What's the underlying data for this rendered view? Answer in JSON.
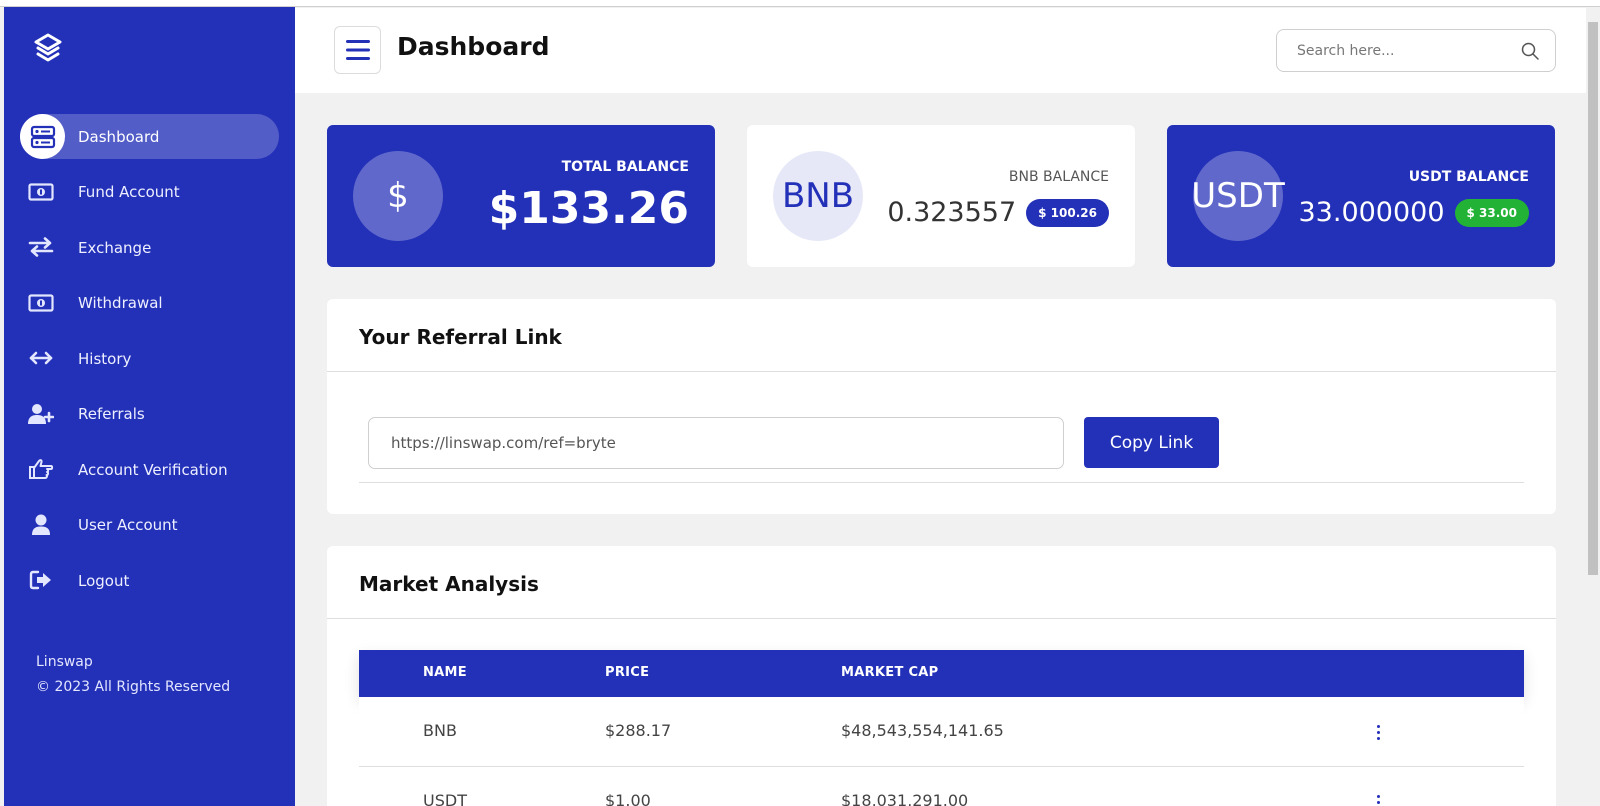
{
  "sidebar": {
    "items": [
      {
        "label": "Dashboard",
        "icon": "server-icon",
        "active": true
      },
      {
        "label": "Fund Account",
        "icon": "money-bill-icon"
      },
      {
        "label": "Exchange",
        "icon": "exchange-arrows-icon"
      },
      {
        "label": "Withdrawal",
        "icon": "money-bill-icon"
      },
      {
        "label": "History",
        "icon": "arrows-horizontal-icon"
      },
      {
        "label": "Referrals",
        "icon": "user-plus-icon"
      },
      {
        "label": "Account Verification",
        "icon": "hand-pointer-icon"
      },
      {
        "label": "User Account",
        "icon": "user-icon"
      },
      {
        "label": "Logout",
        "icon": "sign-out-icon"
      }
    ],
    "footer": {
      "brand": "Linswap",
      "copyright": "© 2023 All Rights Reserved"
    }
  },
  "header": {
    "title": "Dashboard",
    "search_placeholder": "Search here..."
  },
  "cards": {
    "total": {
      "symbol": "$",
      "label": "TOTAL BALANCE",
      "amount": "$133.26"
    },
    "bnb": {
      "symbol": "BNB",
      "label": "BNB BALANCE",
      "amount": "0.323557",
      "badge": "$ 100.26"
    },
    "usdt": {
      "symbol": "USDT",
      "label": "USDT BALANCE",
      "amount": "33.000000",
      "badge": "$ 33.00"
    }
  },
  "referral": {
    "title": "Your Referral Link",
    "link": "https://linswap.com/ref=bryte",
    "button": "Copy Link"
  },
  "market": {
    "title": "Market Analysis",
    "columns": [
      "NAME",
      "PRICE",
      "MARKET CAP"
    ],
    "rows": [
      {
        "name": "BNB",
        "price": "$288.17",
        "market_cap": "$48,543,554,141.65"
      },
      {
        "name": "USDT",
        "price": "$1.00",
        "market_cap": "$18,031,291.00"
      }
    ]
  },
  "colors": {
    "brand": "#2330b8",
    "success": "#22b336",
    "background": "#f1f1f1"
  }
}
